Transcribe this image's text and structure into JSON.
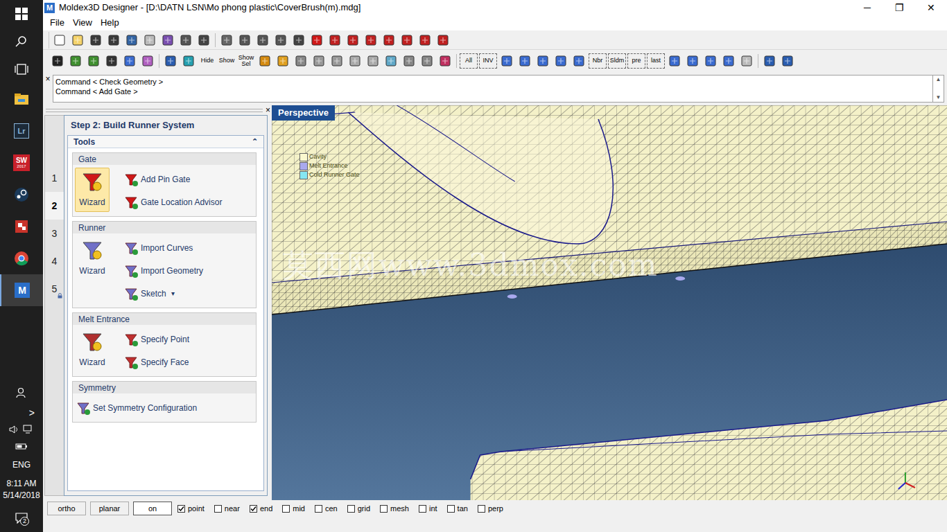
{
  "window": {
    "app_icon": "M",
    "title": "Moldex3D Designer - [D:\\DATN LSN\\Mo phong plastic\\CoverBrush(m).mdg]",
    "controls": [
      "─",
      "❐",
      "✕"
    ]
  },
  "menu": [
    "File",
    "View",
    "Help"
  ],
  "toolbar_text_buttons": [
    "Hide",
    "Show",
    "Show Sel"
  ],
  "view_buttons": [
    "All",
    "INV",
    "Nbr",
    "Sldm",
    "pre",
    "last"
  ],
  "command_panel": {
    "close": "×",
    "lines": [
      "Command < Check Geometry >",
      "Command < Add Gate >"
    ],
    "scroll": [
      "▲",
      "▼"
    ]
  },
  "panel": {
    "close": "×",
    "title": "Step 2: Build Runner System",
    "steps": [
      {
        "label": "1",
        "selected": false,
        "locked": false
      },
      {
        "label": "2",
        "selected": true,
        "locked": false
      },
      {
        "label": "3",
        "selected": false,
        "locked": false
      },
      {
        "label": "4",
        "selected": false,
        "locked": false
      },
      {
        "label": "5",
        "selected": false,
        "locked": true
      }
    ],
    "tools": {
      "label": "Tools",
      "expanded": true,
      "toggle": "⌃"
    },
    "groups": [
      {
        "title": "Gate",
        "wizard": {
          "label": "Wizard",
          "selected": true
        },
        "items": [
          {
            "label": "Add Pin Gate",
            "dropdown": ""
          },
          {
            "label": "Gate Location Advisor",
            "dropdown": ""
          }
        ]
      },
      {
        "title": "Runner",
        "wizard": {
          "label": "Wizard",
          "selected": false
        },
        "items": [
          {
            "label": "Import Curves",
            "dropdown": ""
          },
          {
            "label": "Import Geometry",
            "dropdown": ""
          },
          {
            "label": "Sketch",
            "dropdown": "▾"
          }
        ]
      },
      {
        "title": "Melt Entrance",
        "wizard": {
          "label": "Wizard",
          "selected": false
        },
        "items": [
          {
            "label": "Specify Point",
            "dropdown": ""
          },
          {
            "label": "Specify Face",
            "dropdown": ""
          }
        ]
      },
      {
        "title": "Symmetry",
        "items": [
          {
            "label": "Set Symmetry Configuration",
            "dropdown": ""
          }
        ]
      }
    ]
  },
  "viewport": {
    "label": "Perspective",
    "watermark": "莫西网www.3dmox.com",
    "legend": [
      {
        "label": "Cavity",
        "color": "#fbf8cf"
      },
      {
        "label": "Melt Entrance",
        "color": "#a9a9ee"
      },
      {
        "label": "Cold Runner Gate",
        "color": "#86e6f2"
      }
    ]
  },
  "status_bar": {
    "buttons": [
      {
        "label": "ortho",
        "selected": false
      },
      {
        "label": "planar",
        "selected": false
      },
      {
        "label": "on",
        "selected": true
      }
    ],
    "snaps": [
      {
        "label": "point",
        "checked": true
      },
      {
        "label": "near",
        "checked": false
      },
      {
        "label": "end",
        "checked": true
      },
      {
        "label": "mid",
        "checked": false
      },
      {
        "label": "cen",
        "checked": false
      },
      {
        "label": "grid",
        "checked": false
      },
      {
        "label": "mesh",
        "checked": false
      },
      {
        "label": "int",
        "checked": false
      },
      {
        "label": "tan",
        "checked": false
      },
      {
        "label": "perp",
        "checked": false
      }
    ]
  },
  "taskbar": {
    "apps": [
      {
        "kind": "explorer",
        "label": "",
        "sub": "",
        "selected": false
      },
      {
        "kind": "lightroom",
        "label": "Lr",
        "sub": "",
        "selected": false
      },
      {
        "kind": "solidworks",
        "label": "SW",
        "sub": "2017",
        "selected": false
      },
      {
        "kind": "steam",
        "label": "",
        "sub": "",
        "selected": false
      },
      {
        "kind": "office",
        "label": "",
        "sub": "",
        "selected": false
      },
      {
        "kind": "chrome",
        "label": "",
        "sub": "",
        "selected": false
      },
      {
        "kind": "moldex",
        "label": "M",
        "sub": "",
        "selected": true
      }
    ],
    "expand": ">",
    "language": "ENG",
    "time": "8:11 AM",
    "date": "5/14/2018",
    "notifications": "2"
  }
}
